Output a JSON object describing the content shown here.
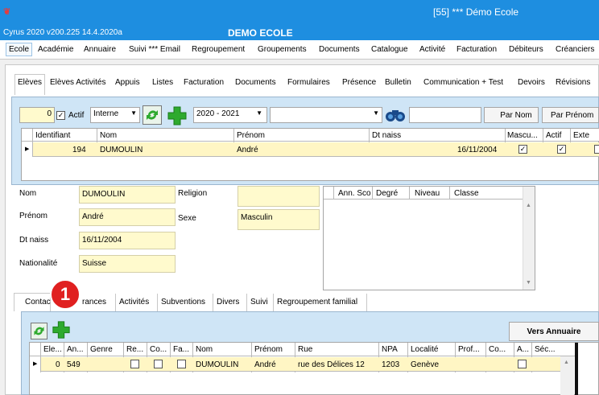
{
  "window": {
    "title": "[55] *** Démo Ecole",
    "version": "Cyrus 2020 v200.225 14.4.2020a",
    "app_name": "DEMO ECOLE"
  },
  "menu": [
    "Ecole",
    "Académie",
    "Annuaire",
    "Suivi *** Email",
    "Regroupement",
    "Groupements",
    "Documents",
    "Catalogue",
    "Activité",
    "Facturation",
    "Débiteurs",
    "Créanciers"
  ],
  "subtabs": [
    "Elèves",
    "Elèves Activités",
    "Appuis",
    "Listes",
    "Facturation",
    "Documents",
    "Formulaires",
    "Présence",
    "Bulletin",
    "Communication + Test",
    "Devoirs",
    "Révisions"
  ],
  "filter": {
    "count": "0",
    "actif_label": "Actif",
    "actif_checked": true,
    "type_value": "Interne",
    "year_value": "2020 - 2021",
    "search_value": "",
    "by_name_label": "Par Nom",
    "by_firstname_label": "Par Prénom"
  },
  "grid": {
    "headers": [
      "Identifiant",
      "Nom",
      "Prénom",
      "Dt naiss",
      "Mascu...",
      "Actif",
      "Exte"
    ],
    "rows": [
      {
        "id": "194",
        "nom": "DUMOULIN",
        "prenom": "André",
        "dt_naiss": "16/11/2004",
        "masculin": true,
        "actif": true
      }
    ]
  },
  "detail": {
    "nom_label": "Nom",
    "nom": "DUMOULIN",
    "prenom_label": "Prénom",
    "prenom": "André",
    "dtnaiss_label": "Dt naiss",
    "dtnaiss": "16/11/2004",
    "nationalite_label": "Nationalité",
    "nationalite": "Suisse",
    "religion_label": "Religion",
    "religion": "",
    "sexe_label": "Sexe",
    "sexe": "Masculin"
  },
  "classes_grid": {
    "headers": [
      "Ann. Sco",
      "Degré",
      "Niveau",
      "Classe"
    ]
  },
  "lower_tabs": [
    "Contacts",
    "Assurances",
    "Activités",
    "Subventions",
    "Divers",
    "Suivi",
    "Regroupement familial"
  ],
  "lower_tab_visible": [
    "Contac",
    "rances"
  ],
  "callout": {
    "number": "1"
  },
  "annuaire_button": "Vers Annuaire",
  "contacts_grid": {
    "headers": [
      "Ele...",
      "An...",
      "Genre",
      "Re...",
      "Co...",
      "Fa...",
      "Nom",
      "Prénom",
      "Rue",
      "NPA",
      "Localité",
      "Prof...",
      "Co...",
      "A...",
      "Séc..."
    ],
    "rows": [
      {
        "ele": "0",
        "an": "549",
        "nom": "DUMOULIN",
        "prenom": "André",
        "rue": "rue des Délices 12",
        "npa": "1203",
        "localite": "Genève"
      }
    ]
  },
  "colors": {
    "titlebar": "#1e8ee0",
    "blue_panel": "#cfe5f6",
    "yellow": "#fffacd",
    "callout": "#e02020",
    "green": "#2eaa2e"
  }
}
